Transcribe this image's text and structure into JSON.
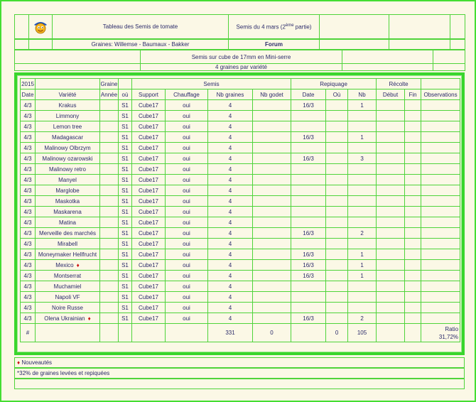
{
  "header": {
    "title": "Tableau des Semis de tomate",
    "semis_prefix": "Semis du 4 mars (2",
    "semis_sup": "ème",
    "semis_suffix": " partie)",
    "graines": "Graines: Willemse - Baumaux - Bakker",
    "forum": "Forum",
    "cube": "Semis sur cube de 17mm  en Mini-serre",
    "graines_par_variete": "4 graines par variété"
  },
  "table": {
    "group_headers": {
      "year": "2015",
      "graine": "Graine",
      "semis": "Semis",
      "repiquage": "Repiquage",
      "recolte": "Récolte"
    },
    "columns": [
      "Date",
      "Variété",
      "Année",
      "où",
      "Support",
      "Chauffage",
      "Nb graines",
      "Nb godet",
      "Date",
      "Où",
      "Nb",
      "Début",
      "Fin",
      "Observations"
    ],
    "rows": [
      {
        "date": "4/3",
        "variete": "Krakus",
        "new": false,
        "ou": "S1",
        "support": "Cube17",
        "chauffage": "oui",
        "nb_graines": "4",
        "rep_date": "16/3",
        "rep_nb": "1"
      },
      {
        "date": "4/3",
        "variete": "Limmony",
        "new": false,
        "ou": "S1",
        "support": "Cube17",
        "chauffage": "oui",
        "nb_graines": "4",
        "rep_date": "",
        "rep_nb": ""
      },
      {
        "date": "4/3",
        "variete": "Lemon tree",
        "new": false,
        "ou": "S1",
        "support": "Cube17",
        "chauffage": "oui",
        "nb_graines": "4",
        "rep_date": "",
        "rep_nb": ""
      },
      {
        "date": "4/3",
        "variete": "Madagascar",
        "new": false,
        "ou": "S1",
        "support": "Cube17",
        "chauffage": "oui",
        "nb_graines": "4",
        "rep_date": "16/3",
        "rep_nb": "1"
      },
      {
        "date": "4/3",
        "variete": "Malinowy Olbrzym",
        "new": false,
        "ou": "S1",
        "support": "Cube17",
        "chauffage": "oui",
        "nb_graines": "4",
        "rep_date": "",
        "rep_nb": ""
      },
      {
        "date": "4/3",
        "variete": "Malinowy ozarowski",
        "new": false,
        "ou": "S1",
        "support": "Cube17",
        "chauffage": "oui",
        "nb_graines": "4",
        "rep_date": "16/3",
        "rep_nb": "3"
      },
      {
        "date": "4/3",
        "variete": "Malinowy retro",
        "new": false,
        "ou": "S1",
        "support": "Cube17",
        "chauffage": "oui",
        "nb_graines": "4",
        "rep_date": "",
        "rep_nb": ""
      },
      {
        "date": "4/3",
        "variete": "Manyel",
        "new": false,
        "ou": "S1",
        "support": "Cube17",
        "chauffage": "oui",
        "nb_graines": "4",
        "rep_date": "",
        "rep_nb": ""
      },
      {
        "date": "4/3",
        "variete": "Marglobe",
        "new": false,
        "ou": "S1",
        "support": "Cube17",
        "chauffage": "oui",
        "nb_graines": "4",
        "rep_date": "",
        "rep_nb": ""
      },
      {
        "date": "4/3",
        "variete": "Maskotka",
        "new": false,
        "ou": "S1",
        "support": "Cube17",
        "chauffage": "oui",
        "nb_graines": "4",
        "rep_date": "",
        "rep_nb": ""
      },
      {
        "date": "4/3",
        "variete": "Maskarena",
        "new": false,
        "ou": "S1",
        "support": "Cube17",
        "chauffage": "oui",
        "nb_graines": "4",
        "rep_date": "",
        "rep_nb": ""
      },
      {
        "date": "4/3",
        "variete": "Matina",
        "new": false,
        "ou": "S1",
        "support": "Cube17",
        "chauffage": "oui",
        "nb_graines": "4",
        "rep_date": "",
        "rep_nb": ""
      },
      {
        "date": "4/3",
        "variete": "Merveille des marchés",
        "new": false,
        "ou": "S1",
        "support": "Cube17",
        "chauffage": "oui",
        "nb_graines": "4",
        "rep_date": "16/3",
        "rep_nb": "2"
      },
      {
        "date": "4/3",
        "variete": "Mirabell",
        "new": false,
        "ou": "S1",
        "support": "Cube17",
        "chauffage": "oui",
        "nb_graines": "4",
        "rep_date": "",
        "rep_nb": ""
      },
      {
        "date": "4/3",
        "variete": "Moneymaker Hellfrucht",
        "new": false,
        "ou": "S1",
        "support": "Cube17",
        "chauffage": "oui",
        "nb_graines": "4",
        "rep_date": "16/3",
        "rep_nb": "1"
      },
      {
        "date": "4/3",
        "variete": "Mexico",
        "new": true,
        "ou": "S1",
        "support": "Cube17",
        "chauffage": "oui",
        "nb_graines": "4",
        "rep_date": "16/3",
        "rep_nb": "1"
      },
      {
        "date": "4/3",
        "variete": "Montserrat",
        "new": false,
        "ou": "S1",
        "support": "Cube17",
        "chauffage": "oui",
        "nb_graines": "4",
        "rep_date": "16/3",
        "rep_nb": "1"
      },
      {
        "date": "4/3",
        "variete": "Muchamiel",
        "new": false,
        "ou": "S1",
        "support": "Cube17",
        "chauffage": "oui",
        "nb_graines": "4",
        "rep_date": "",
        "rep_nb": ""
      },
      {
        "date": "4/3",
        "variete": "Napoli VF",
        "new": false,
        "ou": "S1",
        "support": "Cube17",
        "chauffage": "oui",
        "nb_graines": "4",
        "rep_date": "",
        "rep_nb": ""
      },
      {
        "date": "4/3",
        "variete": "Noire Russe",
        "new": false,
        "ou": "S1",
        "support": "Cube17",
        "chauffage": "oui",
        "nb_graines": "4",
        "rep_date": "",
        "rep_nb": ""
      },
      {
        "date": "4/3",
        "variete": "Olena Ukrainian",
        "new": true,
        "ou": "S1",
        "support": "Cube17",
        "chauffage": "oui",
        "nb_graines": "4",
        "rep_date": "16/3",
        "rep_nb": "2"
      }
    ],
    "totals": {
      "label": "#",
      "nb_graines": "331",
      "nb_godet": "0",
      "rep_ou": "0",
      "rep_nb": "105",
      "ratio_label": "Ratio",
      "ratio_value": "31,72%"
    }
  },
  "footer": {
    "star": "♦",
    "legend": " Nouveautés",
    "note": "*32% de graines levées et repiquées"
  },
  "colors": {
    "border": "#4fd43a",
    "frame": "#39d62c",
    "text": "#2a2a6a",
    "star": "#cc1111",
    "background": "#fbf8e6"
  }
}
